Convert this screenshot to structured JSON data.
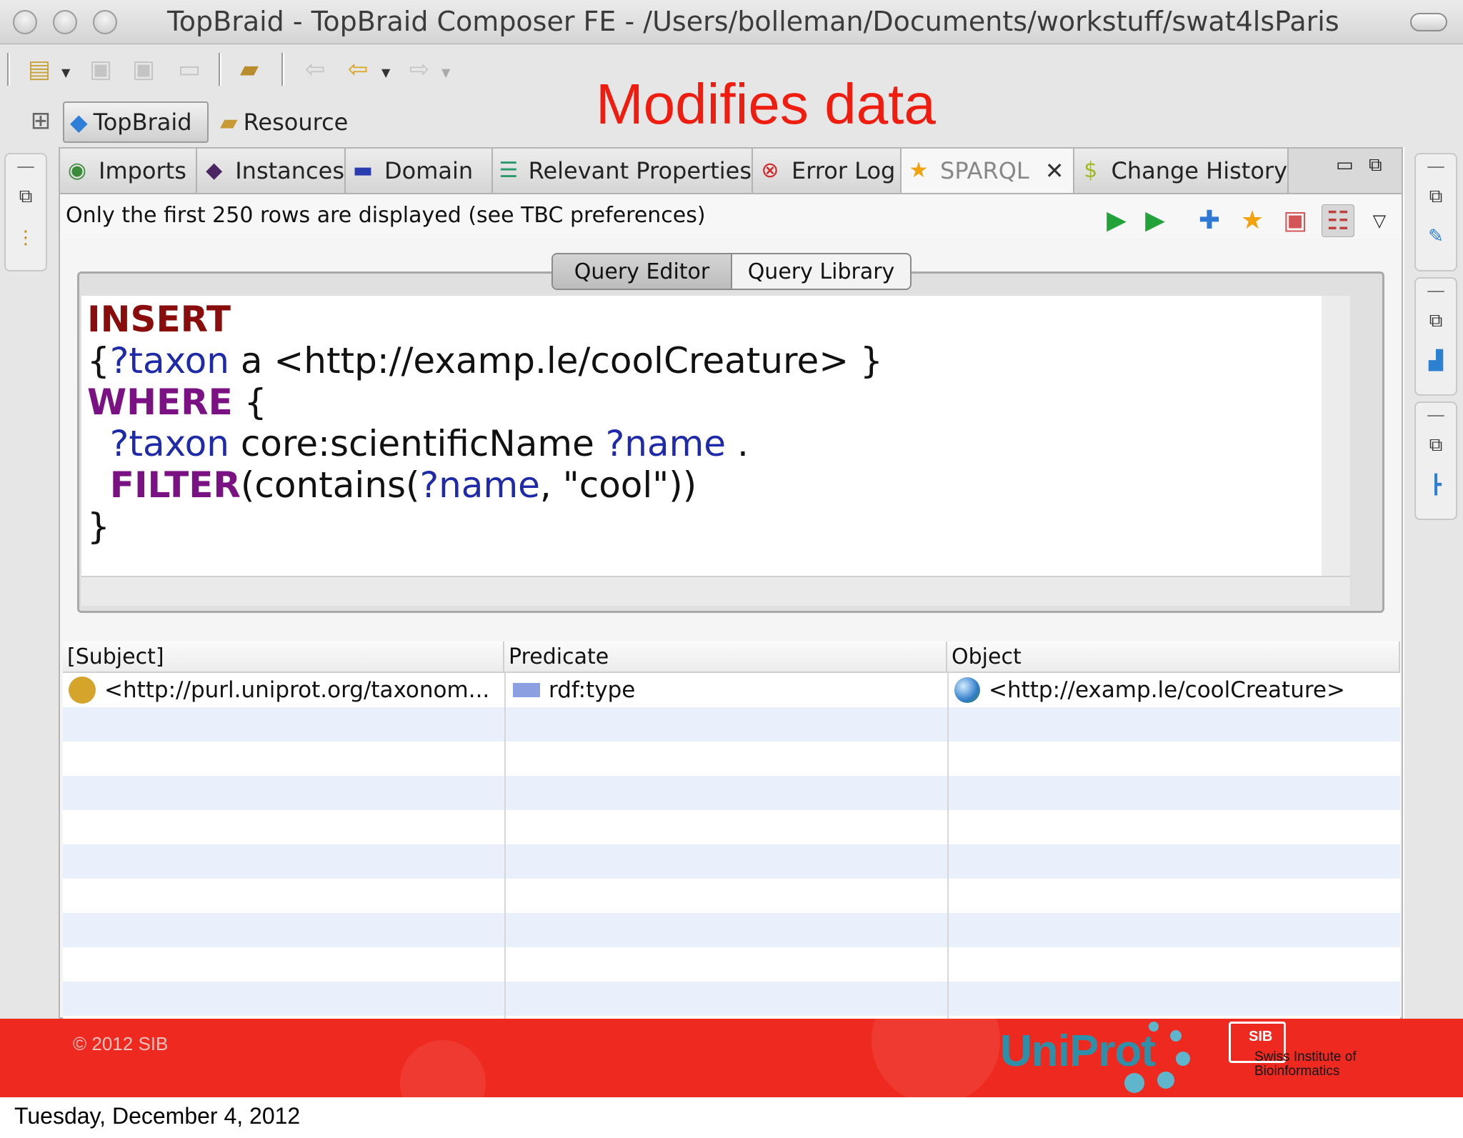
{
  "window": {
    "title": "TopBraid - TopBraid Composer FE - /Users/bolleman/Documents/workstuff/swat4lsParis"
  },
  "toolbar": {
    "icons": [
      "new-icon",
      "save-icon",
      "save-all-icon",
      "print-icon",
      "open-resource-icon",
      "back-icon",
      "back-nav-icon",
      "forward-icon"
    ]
  },
  "perspectives": {
    "topbraid_label": "TopBraid",
    "resource_label": "Resource"
  },
  "annotation": "Modifies data",
  "tabs": [
    {
      "label": "Imports"
    },
    {
      "label": "Instances"
    },
    {
      "label": "Domain"
    },
    {
      "label": "Relevant Properties"
    },
    {
      "label": "Error Log"
    },
    {
      "label": "SPARQL"
    },
    {
      "label": "Change History"
    }
  ],
  "info": "Only the first 250 rows are displayed (see TBC preferences)",
  "editor_tabs": {
    "query_editor": "Query Editor",
    "query_library": "Query Library"
  },
  "query": {
    "l1_kw": "INSERT",
    "l2_a": "{",
    "l2_var": "?taxon",
    "l2_b": " a <http://examp.le/coolCreature> }",
    "l3_kw": "WHERE",
    "l3_b": " {",
    "l4_indent": "  ",
    "l4_var": "?taxon",
    "l4_b": " core:scientificName ",
    "l4_var2": "?name",
    "l4_c": " .",
    "l5_indent": "  ",
    "l5_kw": "FILTER",
    "l5_a": "(contains(",
    "l5_var": "?name",
    "l5_b": ", \"cool\"))",
    "l6": "}"
  },
  "table": {
    "headers": [
      "[Subject]",
      "Predicate",
      "Object"
    ],
    "row": {
      "subject": "<http://purl.uniprot.org/taxonom...",
      "predicate": "rdf:type",
      "object": "<http://examp.le/coolCreature>"
    }
  },
  "footer": {
    "copyright": "© 2012 SIB",
    "uniprot": "UniProt",
    "sib": "SIB",
    "sib_name_1": "Swiss Institute of",
    "sib_name_2": "Bioinformatics",
    "accent": "#ee2a20"
  },
  "date": "Tuesday, December 4, 2012"
}
